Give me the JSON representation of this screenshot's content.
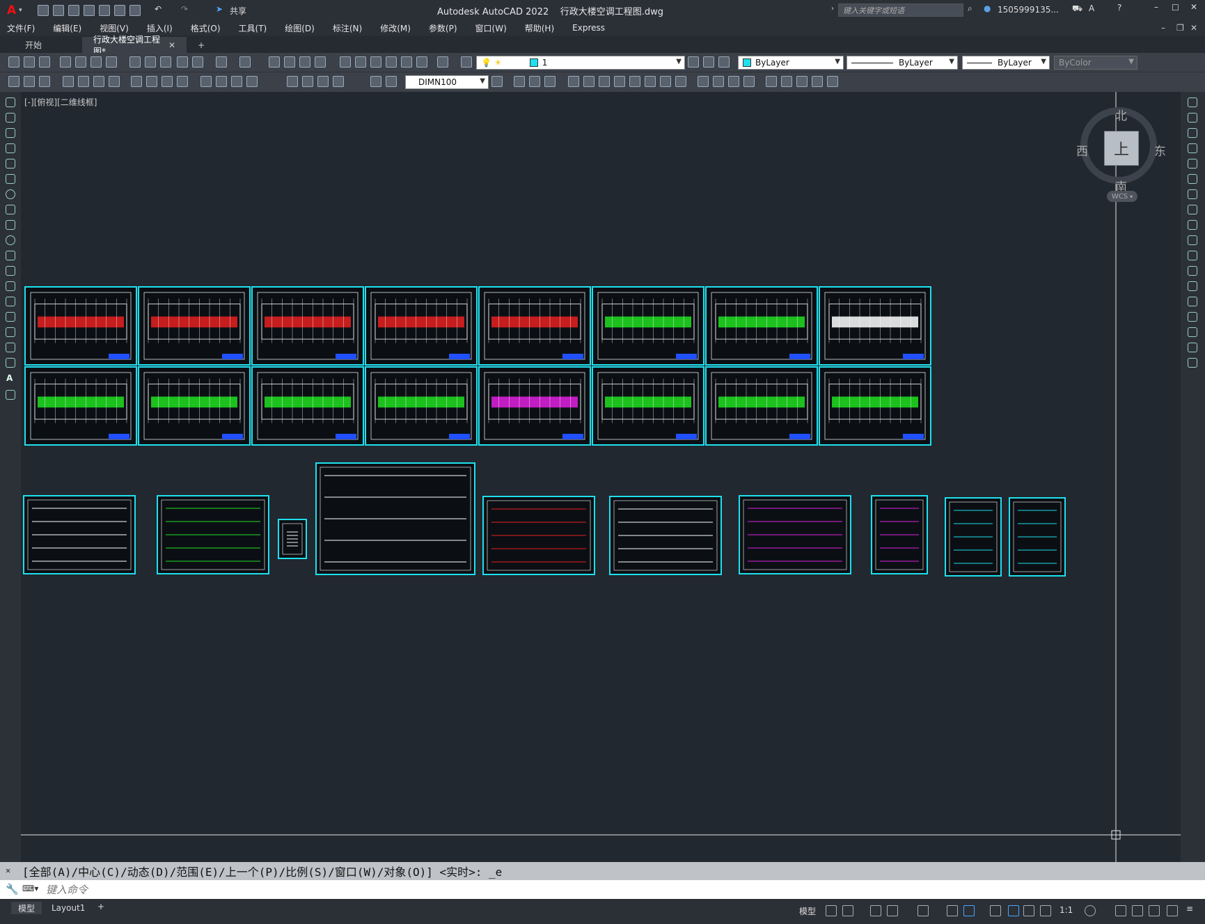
{
  "app": {
    "title": "Autodesk AutoCAD 2022",
    "file_name": "行政大楼空调工程图.dwg",
    "share_label": "共享",
    "search_placeholder": "键入关键字或短语",
    "user": "1505999135...",
    "logo": "A"
  },
  "menu": [
    "文件(F)",
    "编辑(E)",
    "视图(V)",
    "插入(I)",
    "格式(O)",
    "工具(T)",
    "绘图(D)",
    "标注(N)",
    "修改(M)",
    "参数(P)",
    "窗口(W)",
    "帮助(H)",
    "Express"
  ],
  "tabs": [
    {
      "label": "开始",
      "active": false
    },
    {
      "label": "行政大楼空调工程图*",
      "active": true
    }
  ],
  "toolbar": {
    "layer_value": "1",
    "color_value": "ByLayer",
    "linetype_value": "ByLayer",
    "lineweight_value": "ByLayer",
    "plotstyle_value": "ByColor",
    "dimstyle_value": "DIMN100"
  },
  "viewport": {
    "label": "[-][俯视][二维线框]",
    "viewcube": {
      "north": "北",
      "south": "南",
      "east": "东",
      "west": "西",
      "top": "上",
      "wcs": "WCS"
    }
  },
  "command": {
    "history": "[全部(A)/中心(C)/动态(D)/范围(E)/上一个(P)/比例(S)/窗口(W)/对象(O)] <实时>: _e",
    "placeholder": "键入命令"
  },
  "status": {
    "layout_tabs": [
      "模型",
      "Layout1"
    ],
    "model_label": "模型",
    "scale": "1:1"
  },
  "colors": {
    "accent": "#1ee0ee",
    "canvas": "#212830",
    "chrome": "#3b4049"
  }
}
